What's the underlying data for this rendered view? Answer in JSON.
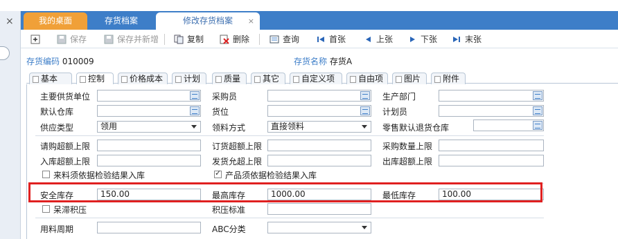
{
  "tabs": [
    {
      "label": "我的桌面"
    },
    {
      "label": "存货档案"
    },
    {
      "label": "修改存货档案",
      "close": "×"
    }
  ],
  "leftstrip": {
    "close": "×"
  },
  "toolbar": {
    "save": "保存",
    "save_new": "保存并新增",
    "copy": "复制",
    "delete": "删除",
    "query": "查询",
    "first": "首张",
    "prev": "上张",
    "next": "下张",
    "last": "末张"
  },
  "header": {
    "code_label": "存货编码",
    "code_value": "010009",
    "name_label": "存货名称",
    "name_value": "存货A"
  },
  "subtabs": [
    "基本",
    "控制",
    "价格成本",
    "计划",
    "质量",
    "其它",
    "自定义项",
    "自由项",
    "图片",
    "附件"
  ],
  "form": {
    "main_supplier": "主要供货单位",
    "buyer": "采购员",
    "prod_dept": "生产部门",
    "default_wh": "默认仓库",
    "location": "货位",
    "planner": "计划员",
    "supply_type": "供应类型",
    "supply_type_value": "领用",
    "pick_method": "领料方式",
    "pick_method_value": "直接领料",
    "retail_return_wh": "零售默认退货仓库",
    "req_over_limit": "请购超额上限",
    "order_over_limit": "订货超额上限",
    "purchase_qty_limit": "采购数量上限",
    "inbound_over_limit": "入库超额上限",
    "ship_allow_limit": "发货允超上限",
    "outbound_over_limit": "出库超额上限",
    "incoming_by_qc": "来料须依据检验结果入库",
    "product_by_qc": "产品须依据检验结果入库",
    "safety_stock": "安全库存",
    "safety_stock_value": "150.00",
    "max_stock": "最高库存",
    "max_stock_value": "1000.00",
    "min_stock": "最低库存",
    "min_stock_value": "100.00",
    "slow_moving": "呆滞积压",
    "backlog_std": "积压标准",
    "lead_time": "用料周期",
    "abc_class": "ABC分类"
  }
}
